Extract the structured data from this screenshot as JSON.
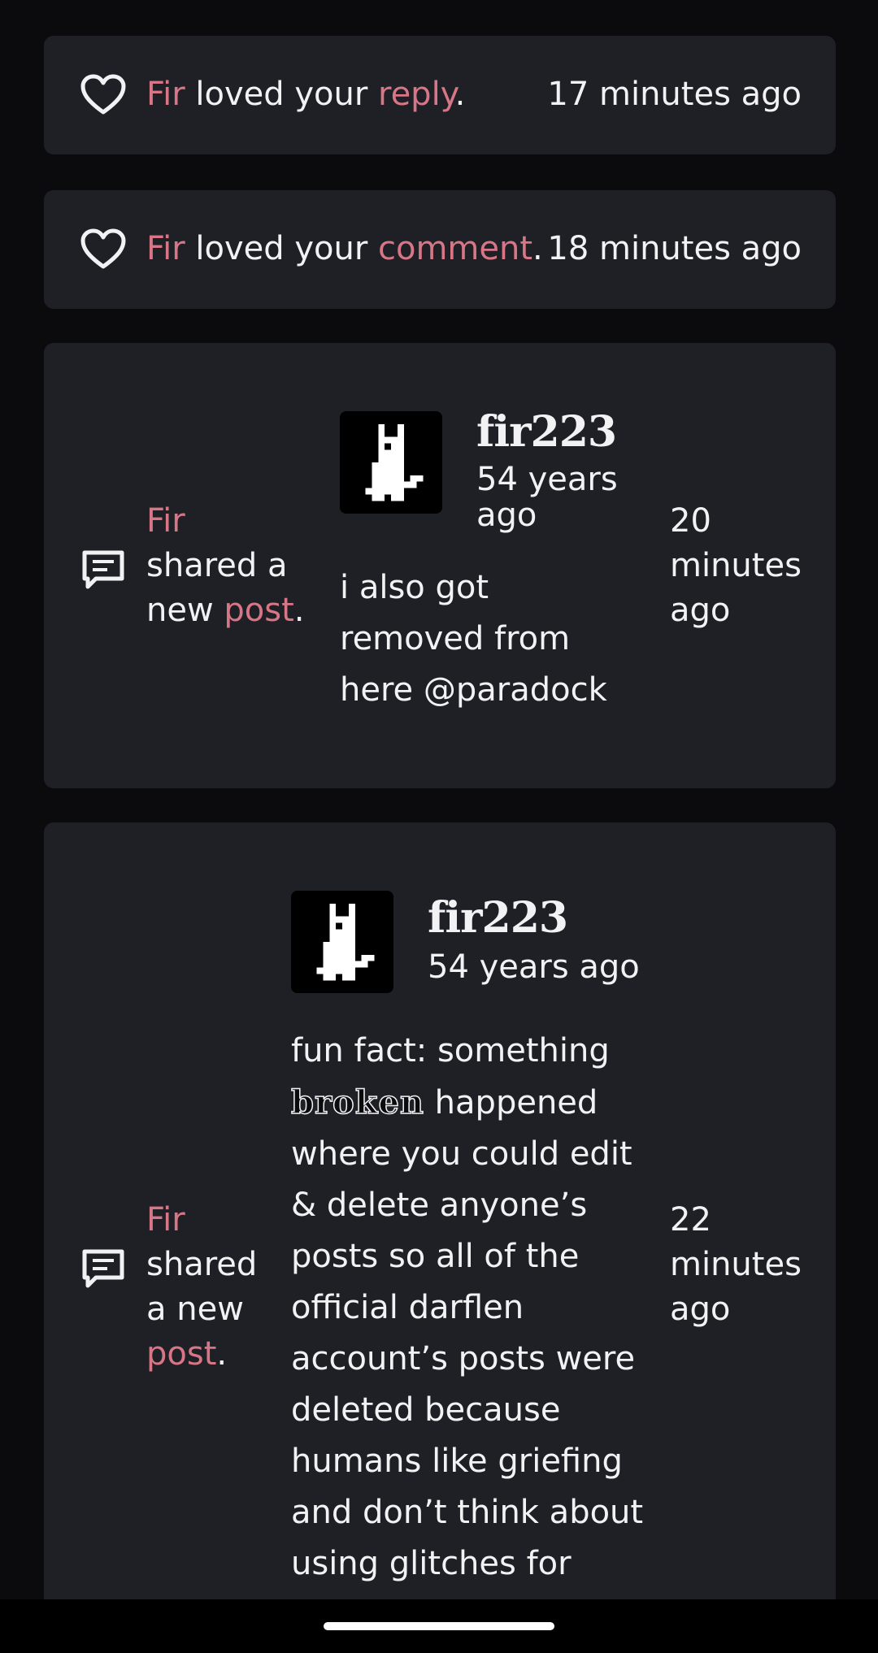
{
  "notifications": [
    {
      "type": "love",
      "actor": "Fir",
      "verb": " loved your ",
      "object": "reply",
      "suffix": ".",
      "time": "17 minutes ago"
    },
    {
      "type": "love",
      "actor": "Fir",
      "verb": " loved your ",
      "object": "comment",
      "suffix": ".",
      "time": "18 minutes ago"
    },
    {
      "type": "post",
      "actor": "Fir",
      "verb_line1": "shared a",
      "verb_line2": "new ",
      "object": "post",
      "suffix": ".",
      "author": "fir223",
      "post_age": "54 years ago",
      "post_text": "i also got removed from here @paradock",
      "time_line1": "20",
      "time_line2": "minutes",
      "time_line3": "ago"
    },
    {
      "type": "post",
      "actor": "Fir",
      "verb_line1": "shared",
      "verb_line2": "a new",
      "object": "post",
      "suffix": ".",
      "author": "fir223",
      "post_age": "54 years ago",
      "post_text_before": "fun fact: something ",
      "post_text_styled": "broken",
      "post_text_after": " happened where you could edit & delete anyone’s posts so all of the official darflen account’s posts were deleted because humans like griefing and don’t think about using glitches for",
      "time_line1": "22",
      "time_line2": "minutes",
      "time_line3": "ago"
    }
  ],
  "icons": {
    "love": "heart-icon",
    "post": "comment-icon"
  },
  "colors": {
    "background": "#0b0b0e",
    "card": "#1f1f26",
    "accent": "#d77686",
    "text": "#f2f2f4"
  }
}
